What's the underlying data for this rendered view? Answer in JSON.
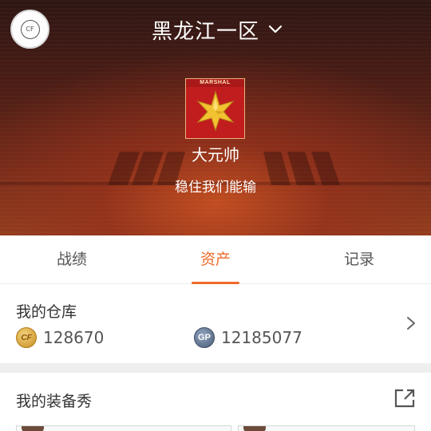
{
  "header": {
    "server_name": "黑龙江一区",
    "avatar_text": "CF"
  },
  "rank": {
    "badge_label": "MARSHAL",
    "name": "大元帅",
    "motto": "稳住我们能输"
  },
  "tabs": [
    {
      "label": "战绩",
      "active": false
    },
    {
      "label": "资产",
      "active": true
    },
    {
      "label": "记录",
      "active": false
    }
  ],
  "warehouse": {
    "title": "我的仓库",
    "cf_coin_icon": "cf-coin-icon",
    "cf_coin_badge": "CF",
    "cf_coin_value": "128670",
    "gp_icon": "gp-coin-icon",
    "gp_badge": "GP",
    "gp_value": "12185077"
  },
  "equipment": {
    "title": "我的装备秀"
  },
  "colors": {
    "accent": "#ef6a2a",
    "hero_dark": "#2e1613",
    "hero_glow": "#c44e20",
    "badge_red": "#c21d1e",
    "star_gold": "#f2c230"
  }
}
